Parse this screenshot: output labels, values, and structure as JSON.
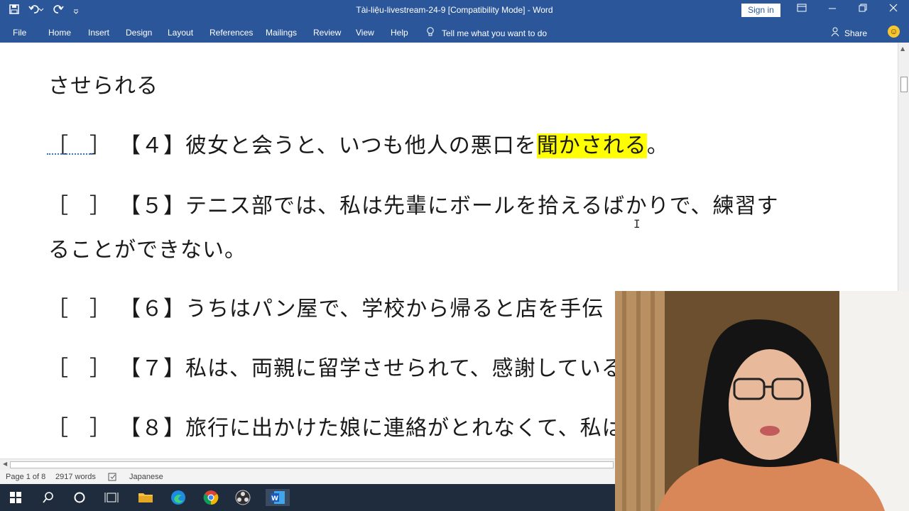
{
  "window": {
    "title": "Tài-liệu-livestream-24-9 [Compatibility Mode]  -  Word",
    "sign_in": "Sign in"
  },
  "ribbon": {
    "tabs": [
      "File",
      "Home",
      "Insert",
      "Design",
      "Layout",
      "References",
      "Mailings",
      "Review",
      "View",
      "Help"
    ],
    "tell_me": "Tell me what you want to do",
    "share": "Share"
  },
  "document": {
    "line_top": "させられる",
    "q4_label": "【４】",
    "q4_text_before": "彼女と会うと、いつも他人の悪口を",
    "q4_highlight": "聞かされる",
    "q4_text_after": "。",
    "q5_label": "【５】",
    "q5_text": "テニス部では、私は先輩にボールを拾えるばかりで、練習す",
    "q5_cont": "ることができない。",
    "q6_label": "【６】",
    "q6_text": "うちはパン屋で、学校から帰ると店を手伝",
    "q7_label": "【７】",
    "q7_text": "私は、両親に留学させられて、感謝している",
    "q8_label": "【８】",
    "q8_text": "旅行に出かけた娘に連絡がとれなくて、私は",
    "checkbox": "［　］"
  },
  "status": {
    "page": "Page 1 of 8",
    "words": "2917 words",
    "language": "Japanese"
  },
  "taskbar": {
    "apps": [
      "windows-start",
      "search",
      "cortana",
      "task-view",
      "file-explorer",
      "edge",
      "chrome",
      "obs",
      "word"
    ]
  },
  "colors": {
    "ribbon": "#2b579a",
    "highlight": "#ffff00",
    "taskbar": "#1f2c3e"
  }
}
